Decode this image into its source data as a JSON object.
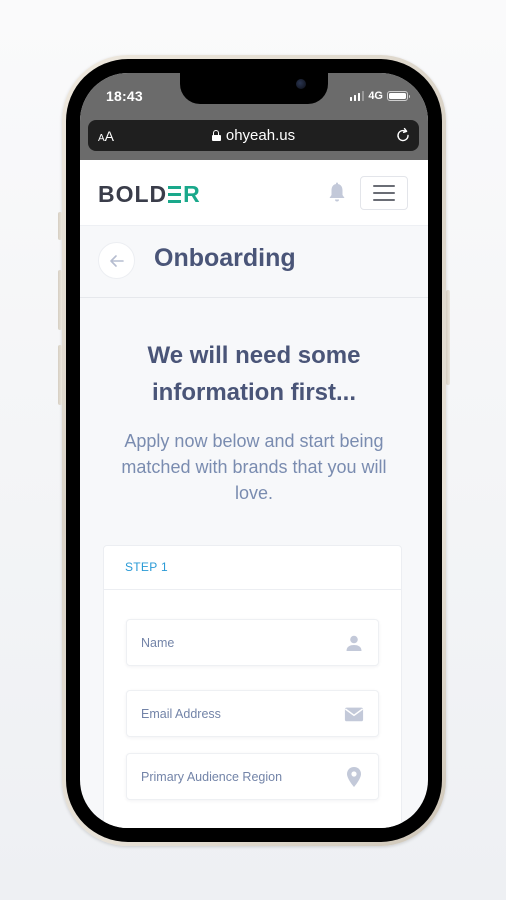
{
  "status_bar": {
    "time": "18:43",
    "network": "4G",
    "signal_bars_active": 3,
    "signal_bars_total": 4,
    "battery_level": 1.0
  },
  "browser": {
    "text_size_label": "AA",
    "url": "ohyeah.us",
    "lock_icon": "lock-icon",
    "reload_icon": "reload-icon"
  },
  "header": {
    "logo_prefix": "BOLD",
    "logo_suffix": "R",
    "logo_accent_color": "#1aa88b",
    "notification_icon": "bell-icon",
    "menu_icon": "hamburger-icon"
  },
  "page": {
    "back_icon": "arrow-left-icon",
    "title": "Onboarding"
  },
  "intro": {
    "heading": "We will need some information first...",
    "subtext": "Apply now below and start being matched with brands that you will love."
  },
  "form": {
    "step_label": "STEP 1",
    "step_color": "#2a9ad6",
    "fields": [
      {
        "placeholder": "Name",
        "value": "",
        "icon": "user-icon"
      },
      {
        "placeholder": "Email Address",
        "value": "",
        "icon": "envelope-icon"
      },
      {
        "placeholder": "Primary Audience Region",
        "value": "",
        "icon": "map-pin-icon"
      }
    ]
  }
}
